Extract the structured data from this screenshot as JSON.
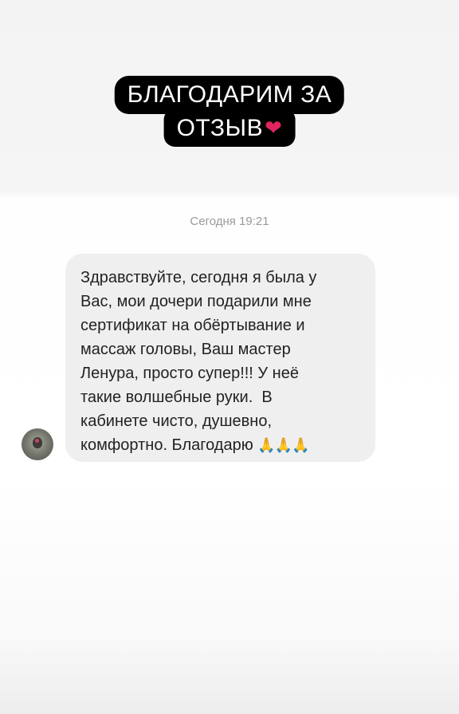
{
  "story_title": {
    "line1": "БЛАГОДАРИМ ЗА",
    "line2": "ОТЗЫВ",
    "heart_emoji": "❤"
  },
  "chat": {
    "timestamp": "Сегодня 19:21",
    "message": {
      "text": "Здравствуйте, сегодня я была у\nВас, мои дочери подарили мне\nсертификат на обёртывание и\nмассаж головы, Ваш мастер\nЛенура, просто супер!!! У неё\nтакие волшебные руки.  В\nкабинете чисто, душевно,\nкомфортно. Благодарю ",
      "emoji": "🙏🙏🙏"
    },
    "avatar": {
      "icon": "user-avatar"
    }
  },
  "colors": {
    "title_bg": "#000000",
    "title_text": "#ffffff",
    "bubble_bg": "#efefef",
    "timestamp_text": "#9a9a9a",
    "heart": "#e0245e"
  }
}
